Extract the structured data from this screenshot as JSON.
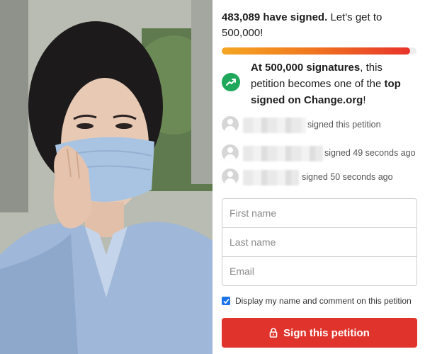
{
  "photo": {
    "icon": "woman-wearing-face-mask-photo"
  },
  "counter": {
    "count": "483,089 have signed.",
    "goal_text": "Let's get to 500,000!",
    "progress": 0.966
  },
  "goal": {
    "icon": "trending-up-icon",
    "accent": "#1fa85b",
    "part1": "At 500,000 signatures",
    "part2": ", this petition becomes one of the ",
    "part3": "top signed on Change.org",
    "part4": "!"
  },
  "signers": [
    {
      "status": "signed this petition"
    },
    {
      "status": "signed 49 seconds ago"
    },
    {
      "status": "signed 50 seconds ago"
    }
  ],
  "form": {
    "first_name_placeholder": "First name",
    "last_name_placeholder": "Last name",
    "email_placeholder": "Email",
    "display_label": "Display my name and comment on this petition",
    "display_checked": true
  },
  "button": {
    "label": "Sign this petition",
    "icon": "lock-icon",
    "color": "#e0332b"
  }
}
